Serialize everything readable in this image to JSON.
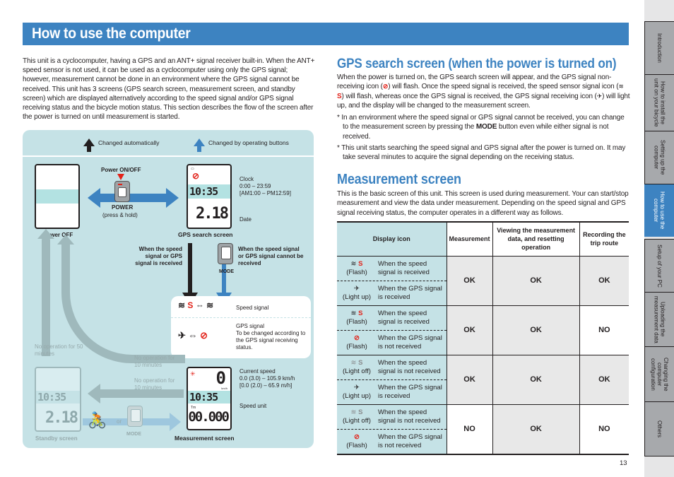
{
  "page": {
    "title": "How to use the computer",
    "number": "13"
  },
  "intro": "This unit is a cyclocomputer, having a GPS and an ANT+ signal receiver built-in. When the ANT+ speed sensor is not used, it can be used as a cyclocomputer using only the GPS signal; however, measurement cannot be done in an environment where the GPS signal cannot be received. This unit has 3 screens  (GPS search screen, measurement screen, and standby screen) which are displayed alternatively according to the speed signal and/or GPS signal receiving status and the bicycle motion status. This section describes the flow of the screen after the power is turned on until measurement is started.",
  "diagram": {
    "legend": {
      "auto": "Changed automatically",
      "buttons": "Changed by operating buttons"
    },
    "power_off_label": "Power OFF",
    "power_on_off_label": "Power ON/OFF",
    "power_button_label": "POWER",
    "power_button_hint": "(press & hold)",
    "gps_search_label": "GPS search screen",
    "clock_label": "Clock",
    "clock_range": "0:00 – 23:59",
    "clock_range_12h": "[AM1:00 – PM12:59]",
    "date_label": "Date",
    "lcd_time": "10:35",
    "lcd_date": "2.18",
    "lcd_speed": "0",
    "lcd_trip": "00.000",
    "received_label": "When the speed signal or GPS signal is received",
    "not_received_label": "When the speed signal or GPS signal cannot be received",
    "mode_label": "MODE",
    "speed_signal_label": "Speed signal",
    "gps_signal_title": "GPS signal",
    "gps_signal_desc": "To be changed according to the GPS signal receiving status.",
    "no_op_50": "No operation for 50 minutes",
    "no_op_10a": "No operation for 10 minutes",
    "no_op_10b": "No operation for 10 minutes",
    "or_label": "or",
    "standby_label": "Standby screen",
    "measurement_label": "Measurement screen",
    "current_speed_label": "Current speed",
    "current_speed_range": "0.0 (3.0) – 105.9 km/h",
    "current_speed_range_mph": "[0.0 (2.0) – 65.9 m/h]",
    "speed_unit_label": "Speed unit",
    "tm_label": "Tm",
    "kmh_label": "km/h"
  },
  "gps_section": {
    "heading": "GPS search screen (when the power is turned on)",
    "p1": "When the power is turned on, the GPS search screen will appear, and the GPS signal non-receiving icon (",
    "p2": ") will flash. Once the speed signal is received, the speed sensor signal icon (",
    "p3": ") will flash, whereas once the GPS signal is received, the GPS signal receiving icon (",
    "p4": ") will light up, and the display will be changed to the measurement screen.",
    "note1_a": "* In an environment where the speed signal or GPS signal cannot be received, you can change to the measurement screen by pressing the ",
    "note1_mode": "MODE",
    "note1_b": " button even while either signal is not received.",
    "note2": "* This unit starts searching the speed signal and GPS signal after the power is turned on. It may take several minutes to acquire the signal depending on the receiving status."
  },
  "measurement_section": {
    "heading": "Measurement screen",
    "body": "This is the basic screen of this unit. This screen is used during measurement. Your can start/stop measurement and view the data under measurement. Depending on the speed signal and GPS signal receiving status, the computer operates in a different way as follows.",
    "table": {
      "headers": [
        "Display icon",
        "Measurement",
        "Viewing the measurement data, and resetting operation",
        "Recording the trip route"
      ],
      "rows": [
        {
          "speed_state": "(Flash)",
          "speed_text": "When the speed signal is received",
          "gps_state": "(Light up)",
          "gps_text": "When the GPS signal is received",
          "measurement": "OK",
          "viewing": "OK",
          "recording": "OK"
        },
        {
          "speed_state": "(Flash)",
          "speed_text": "When the speed signal is received",
          "gps_state": "(Flash)",
          "gps_text": "When the GPS signal is not received",
          "measurement": "OK",
          "viewing": "OK",
          "recording": "NO"
        },
        {
          "speed_state": "(Light off)",
          "speed_text": "When the speed signal is not received",
          "gps_state": "(Light up)",
          "gps_text": "When the GPS signal is received",
          "measurement": "OK",
          "viewing": "OK",
          "recording": "OK"
        },
        {
          "speed_state": "(Light off)",
          "speed_text": "When the speed signal is not received",
          "gps_state": "(Flash)",
          "gps_text": "When the GPS signal is not received",
          "measurement": "NO",
          "viewing": "OK",
          "recording": "NO"
        }
      ]
    }
  },
  "sidebar": {
    "tabs": [
      {
        "label": "Introduction"
      },
      {
        "label": "How to install the\nunit on your bicycle"
      },
      {
        "label": "Setting up the\ncomputer"
      },
      {
        "label": "How to use the\ncomputer",
        "active": true
      },
      {
        "label": "Setup of your PC"
      },
      {
        "label": "Uploading the\nmeasurement data"
      },
      {
        "label": "Changing the\ncomputer\nconfiguration"
      },
      {
        "label": "Others"
      }
    ]
  },
  "colors": {
    "brand_blue": "#3d83c1",
    "panel_teal": "#c5e2e6",
    "lcd_band": "#b3e2e2",
    "signal_red": "#e2231a",
    "tab_grey": "#a7a9ac"
  }
}
